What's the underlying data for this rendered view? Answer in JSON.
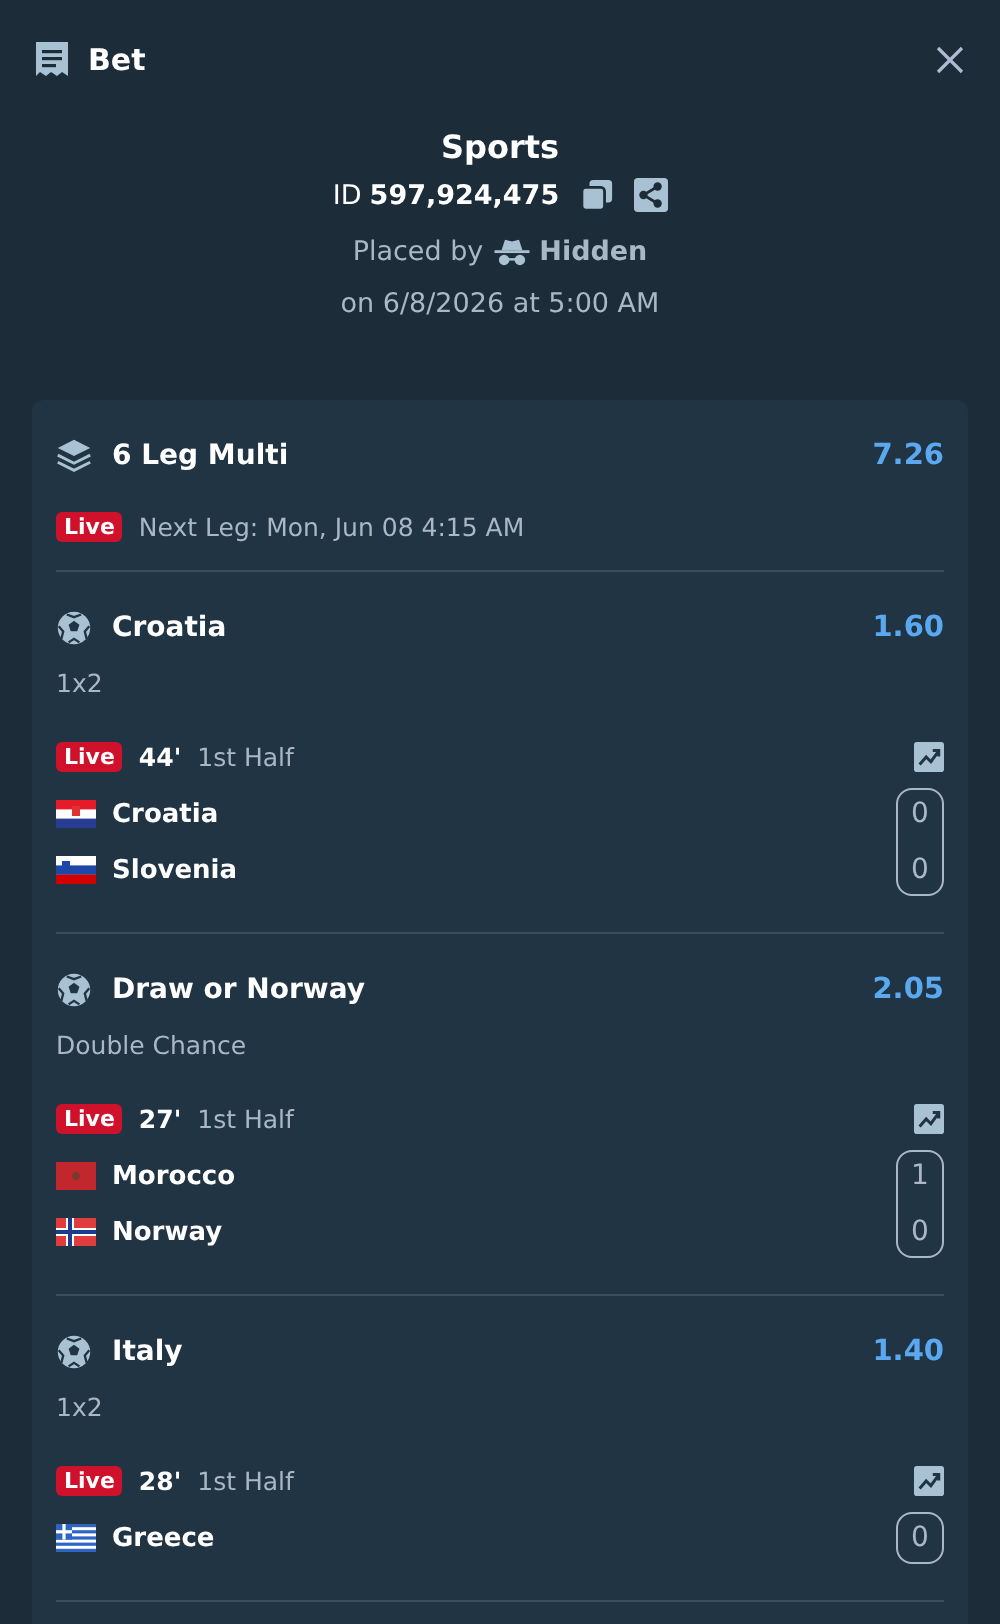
{
  "header": {
    "title": "Bet"
  },
  "summary": {
    "category": "Sports",
    "id_label": "ID",
    "id": "597,924,475",
    "placed_by_label": "Placed by",
    "user": "Hidden",
    "placed_on": "on 6/8/2026 at 5:00 AM"
  },
  "multi": {
    "title": "6 Leg Multi",
    "odds": "7.26",
    "live_badge": "Live",
    "next_leg": "Next Leg: Mon, Jun 08 4:15 AM"
  },
  "legs": [
    {
      "selection": "Croatia",
      "odds": "1.60",
      "market": "1x2",
      "live_badge": "Live",
      "minute": "44'",
      "period": "1st Half",
      "teams": [
        {
          "name": "Croatia",
          "kind": "croatia",
          "score": "0"
        },
        {
          "name": "Slovenia",
          "kind": "slovenia",
          "score": "0"
        }
      ]
    },
    {
      "selection": "Draw or Norway",
      "odds": "2.05",
      "market": "Double Chance",
      "live_badge": "Live",
      "minute": "27'",
      "period": "1st Half",
      "teams": [
        {
          "name": "Morocco",
          "kind": "morocco",
          "score": "1"
        },
        {
          "name": "Norway",
          "kind": "norway",
          "score": "0"
        }
      ]
    },
    {
      "selection": "Italy",
      "odds": "1.40",
      "market": "1x2",
      "live_badge": "Live",
      "minute": "28'",
      "period": "1st Half",
      "teams": [
        {
          "name": "Greece",
          "kind": "greece",
          "score": "0"
        }
      ]
    }
  ]
}
